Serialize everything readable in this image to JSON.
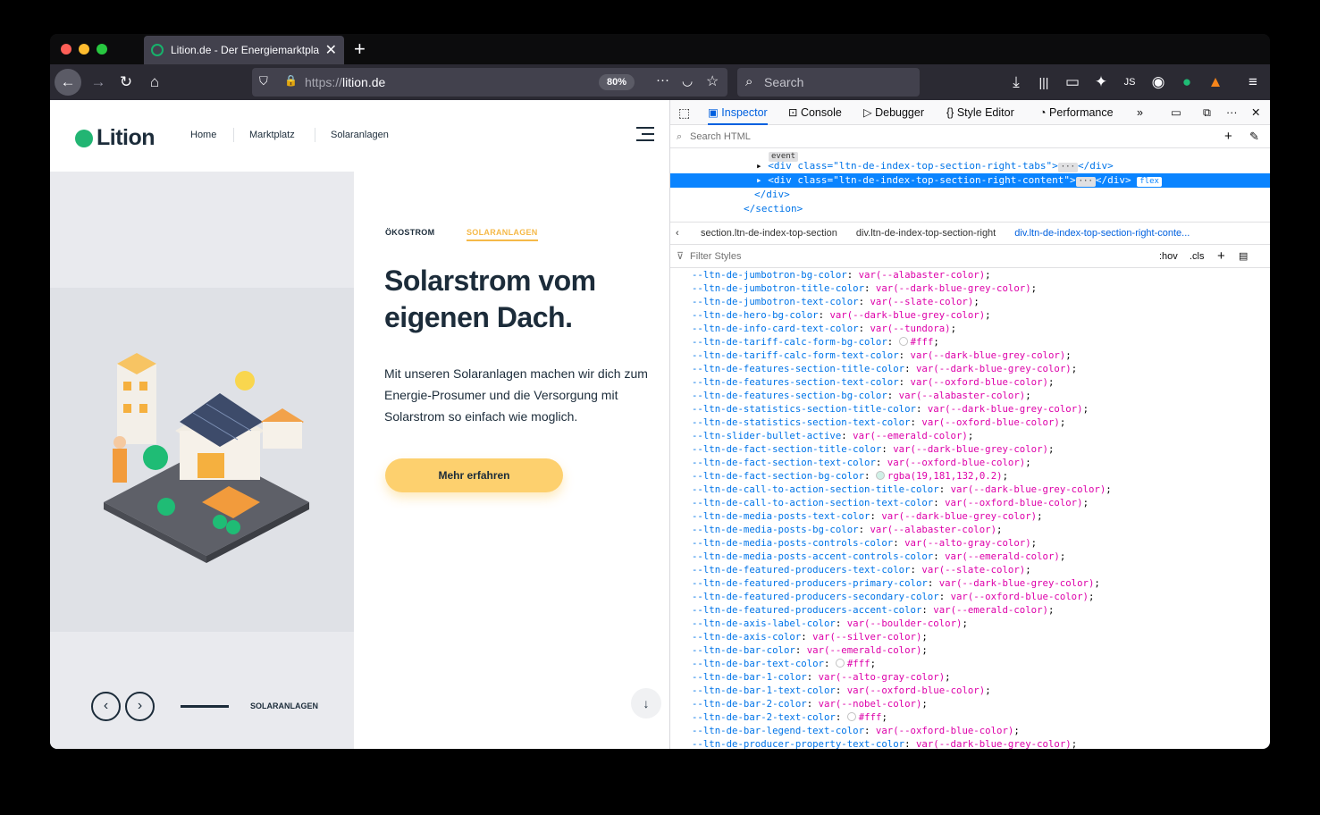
{
  "browser": {
    "tab_title": "Lition.de - Der Energiemarktpla",
    "new_tab": "+",
    "url_protocol": "https://",
    "url_domain": "lition.de",
    "zoom": "80%",
    "search_placeholder": "Search"
  },
  "page": {
    "logo": "Lition",
    "nav": [
      "Home",
      "Marktplatz",
      "Solaranlagen"
    ],
    "section_tabs": [
      "ÖKOSTROM",
      "SOLARANLAGEN"
    ],
    "headline": "Solarstrom vom eigenen Dach.",
    "lead": "Mit unseren Solaranlagen machen wir dich zum Energie-Prosumer und die Versorgung mit Solarstrom so einfach wie moglich.",
    "cta": "Mehr erfahren",
    "slider_label": "SOLARANLAGEN",
    "prev": "‹",
    "next": "›",
    "down": "↓"
  },
  "devtools": {
    "tabs": [
      "Inspector",
      "Console",
      "Debugger",
      "Style Editor",
      "Performance"
    ],
    "search_html": "Search HTML",
    "filter_styles": "Filter Styles",
    "hov": ":hov",
    "cls": ".cls",
    "markup_event_badge": "event",
    "markup_flex_badge": "flex",
    "markup_lines": [
      "<div class=\"ltn-de-index-top-section-right-tabs\">",
      "<div class=\"ltn-de-index-top-section-right-content\">",
      "</div>",
      "</section>"
    ],
    "breadcrumbs": [
      "section.ltn-de-index-top-section",
      "div.ltn-de-index-top-section-right",
      "div.ltn-de-index-top-section-right-conte..."
    ],
    "css_rules": [
      [
        "--ltn-de-jumbotron-bg-color",
        "var(--alabaster-color)"
      ],
      [
        "--ltn-de-jumbotron-title-color",
        "var(--dark-blue-grey-color)"
      ],
      [
        "--ltn-de-jumbotron-text-color",
        "var(--slate-color)"
      ],
      [
        "--ltn-de-hero-bg-color",
        "var(--dark-blue-grey-color)"
      ],
      [
        "--ltn-de-info-card-text-color",
        "var(--tundora)"
      ],
      [
        "--ltn-de-tariff-calc-form-bg-color",
        "#fff"
      ],
      [
        "--ltn-de-tariff-calc-form-text-color",
        "var(--dark-blue-grey-color)"
      ],
      [
        "--ltn-de-features-section-title-color",
        "var(--dark-blue-grey-color)"
      ],
      [
        "--ltn-de-features-section-text-color",
        "var(--oxford-blue-color)"
      ],
      [
        "--ltn-de-features-section-bg-color",
        "var(--alabaster-color)"
      ],
      [
        "--ltn-de-statistics-section-title-color",
        "var(--dark-blue-grey-color)"
      ],
      [
        "--ltn-de-statistics-section-text-color",
        "var(--oxford-blue-color)"
      ],
      [
        "--ltn-slider-bullet-active",
        "var(--emerald-color)"
      ],
      [
        "--ltn-de-fact-section-title-color",
        "var(--dark-blue-grey-color)"
      ],
      [
        "--ltn-de-fact-section-text-color",
        "var(--oxford-blue-color)"
      ],
      [
        "--ltn-de-fact-section-bg-color",
        "rgba(19,181,132,0.2)"
      ],
      [
        "--ltn-de-call-to-action-section-title-color",
        "var(--dark-blue-grey-color)"
      ],
      [
        "--ltn-de-call-to-action-section-text-color",
        "var(--oxford-blue-color)"
      ],
      [
        "--ltn-de-media-posts-text-color",
        "var(--dark-blue-grey-color)"
      ],
      [
        "--ltn-de-media-posts-bg-color",
        "var(--alabaster-color)"
      ],
      [
        "--ltn-de-media-posts-controls-color",
        "var(--alto-gray-color)"
      ],
      [
        "--ltn-de-media-posts-accent-controls-color",
        "var(--emerald-color)"
      ],
      [
        "--ltn-de-featured-producers-text-color",
        "var(--slate-color)"
      ],
      [
        "--ltn-de-featured-producers-primary-color",
        "var(--dark-blue-grey-color)"
      ],
      [
        "--ltn-de-featured-producers-secondary-color",
        "var(--oxford-blue-color)"
      ],
      [
        "--ltn-de-featured-producers-accent-color",
        "var(--emerald-color)"
      ],
      [
        "--ltn-de-axis-label-color",
        "var(--boulder-color)"
      ],
      [
        "--ltn-de-axis-color",
        "var(--silver-color)"
      ],
      [
        "--ltn-de-bar-color",
        "var(--emerald-color)"
      ],
      [
        "--ltn-de-bar-text-color",
        "#fff"
      ],
      [
        "--ltn-de-bar-1-color",
        "var(--alto-gray-color)"
      ],
      [
        "--ltn-de-bar-1-text-color",
        "var(--oxford-blue-color)"
      ],
      [
        "--ltn-de-bar-2-color",
        "var(--nobel-color)"
      ],
      [
        "--ltn-de-bar-2-text-color",
        "#fff"
      ],
      [
        "--ltn-de-bar-legend-text-color",
        "var(--oxford-blue-color)"
      ],
      [
        "--ltn-de-producer-property-text-color",
        "var(--dark-blue-grey-color)"
      ]
    ]
  },
  "colors": {
    "brand_green": "#22b573",
    "cta_yellow": "#fdd06e",
    "text_dark": "#1c2c3a",
    "devtools_accent": "#0a84ff"
  }
}
